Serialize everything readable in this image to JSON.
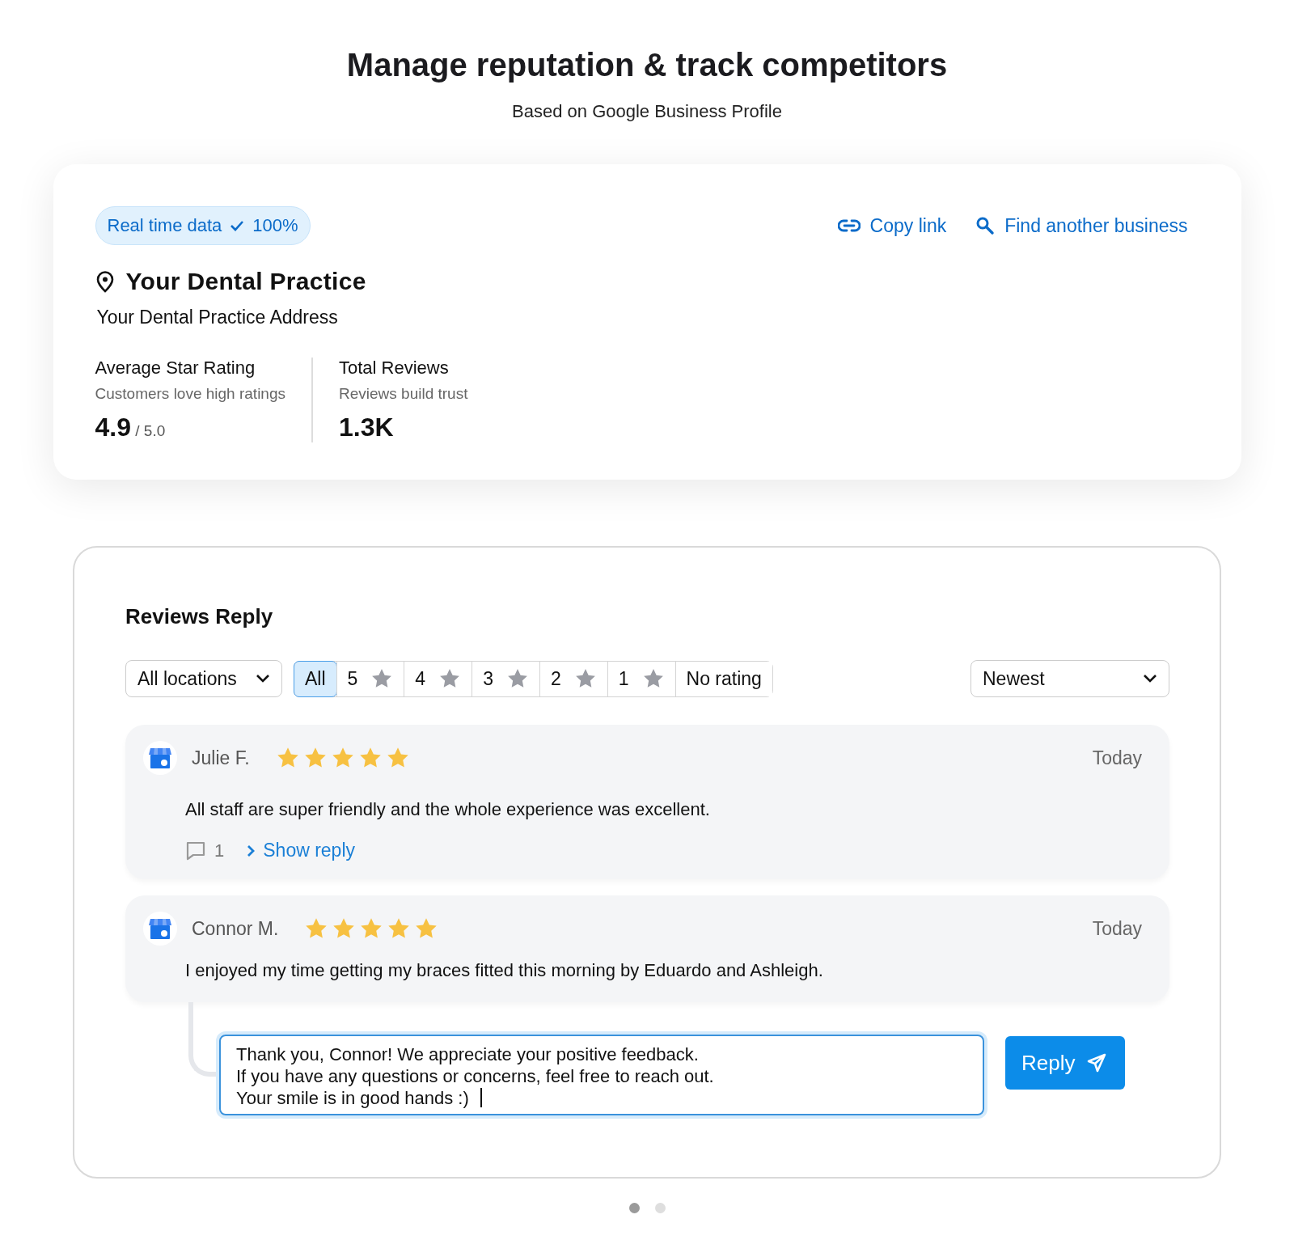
{
  "header": {
    "title": "Manage reputation & track competitors",
    "subtitle": "Based on Google Business Profile"
  },
  "business": {
    "badge": {
      "label": "Real time data",
      "value": "100%"
    },
    "links": [
      {
        "label": "Copy link",
        "kind": "link"
      },
      {
        "label": "Find another business",
        "kind": "search"
      }
    ],
    "name": "Your Dental Practice",
    "address": "Your Dental Practice Address",
    "stats": [
      {
        "label": "Average Star Rating",
        "hint": "Customers love high ratings",
        "value": "4.9",
        "suffix": "/ 5.0"
      },
      {
        "label": "Total Reviews",
        "hint": "Reviews build trust",
        "value": "1.3K"
      }
    ]
  },
  "reviews": {
    "title": "Reviews Reply",
    "location_filter": "All locations",
    "rating_filters": [
      {
        "label": "All",
        "kind": "plain",
        "selected": true
      },
      {
        "label": "5",
        "kind": "star",
        "selected": false
      },
      {
        "label": "4",
        "kind": "star",
        "selected": false
      },
      {
        "label": "3",
        "kind": "star",
        "selected": false
      },
      {
        "label": "2",
        "kind": "star",
        "selected": false
      },
      {
        "label": "1",
        "kind": "star",
        "selected": false
      },
      {
        "label": "No rating",
        "kind": "plain",
        "selected": false
      }
    ],
    "sort": "Newest",
    "items": [
      {
        "author": "Julie F.",
        "stars": 5,
        "date": "Today",
        "text": "All staff are super friendly and the whole experience was excellent.",
        "reply_count": "1",
        "show_reply": "Show reply"
      },
      {
        "author": "Connor M.",
        "stars": 5,
        "date": "Today",
        "text": "I enjoyed my time getting my braces fitted this morning by Eduardo and Ashleigh."
      }
    ],
    "reply_draft": "Thank you, Connor! We appreciate your positive feedback.\nIf you have any questions or concerns, feel free to reach out.\nYour smile is in good hands :)",
    "reply_button": "Reply"
  },
  "pager": [
    {
      "selected": true
    },
    {
      "selected": false
    }
  ]
}
